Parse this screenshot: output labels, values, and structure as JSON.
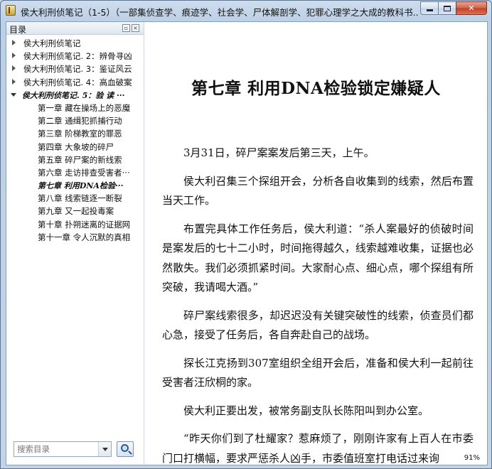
{
  "window": {
    "title": "侯大利刑侦笔记（1-5）（一部集侦查学、痕迹学、社会学、尸体解剖学、犯罪心理学之大成的教科书..."
  },
  "sidebar": {
    "title": "目录",
    "books": [
      {
        "label": "侯大利刑侦笔记"
      },
      {
        "label": "侯大利刑侦笔记. 2：辨骨寻凶"
      },
      {
        "label": "侯大利刑侦笔记. 3：鉴证风云"
      },
      {
        "label": "侯大利刑侦笔记. 4：高血破案"
      },
      {
        "label": "侯大利刑侦笔记. 5：验 读 ···"
      }
    ],
    "chapters": [
      {
        "label": "第一章  藏在操场上的恶魔"
      },
      {
        "label": "第二章  通缉犯抓捕行动"
      },
      {
        "label": "第三章  阶梯教室的罪恶"
      },
      {
        "label": "第四章  大象坡的碎尸"
      },
      {
        "label": "第五章  碎尸案的新线索"
      },
      {
        "label": "第六章  走访排查受害者···"
      },
      {
        "label": "第七章  利用DNA检验···"
      },
      {
        "label": "第八章  线索链逐一断裂"
      },
      {
        "label": "第九章  又一起投毒案"
      },
      {
        "label": "第十章  扑朔迷离的证据网"
      },
      {
        "label": "第十一章  令人沉默的真相"
      }
    ],
    "search_placeholder": "搜索目录"
  },
  "reader": {
    "chapter_title": "第七章 利用DNA检验锁定嫌疑人",
    "paragraphs": [
      "3月31日，碎尸案案发后第三天，上午。",
      "侯大利召集三个探组开会，分析各自收集到的线索，然后布置当天工作。",
      "布置完具体工作任务后，侯大利道：“杀人案最好的侦破时间是案发后的七十二小时，时间拖得越久，线索越难收集，证据也必然散失。我们必须抓紧时间。大家耐心点、细心点，哪个探组有所突破，我请喝大酒。”",
      "碎尸案线索很多，却迟迟没有关键突破性的线索，侦查员们都心急，接受了任务后，各自奔赴自己的战场。",
      "探长江克扬到307室组织全组开会后，准备和侯大利一起前往受害者汪欣桐的家。",
      "侯大利正要出发，被常务副支队长陈阳叫到办公室。",
      "“昨天你们到了杜耀家？惹麻烦了，刚刚许家有上百人在市委门口打横幅，要求严惩杀人凶手，市委值班室打电话过来询"
    ],
    "progress": "91%"
  }
}
